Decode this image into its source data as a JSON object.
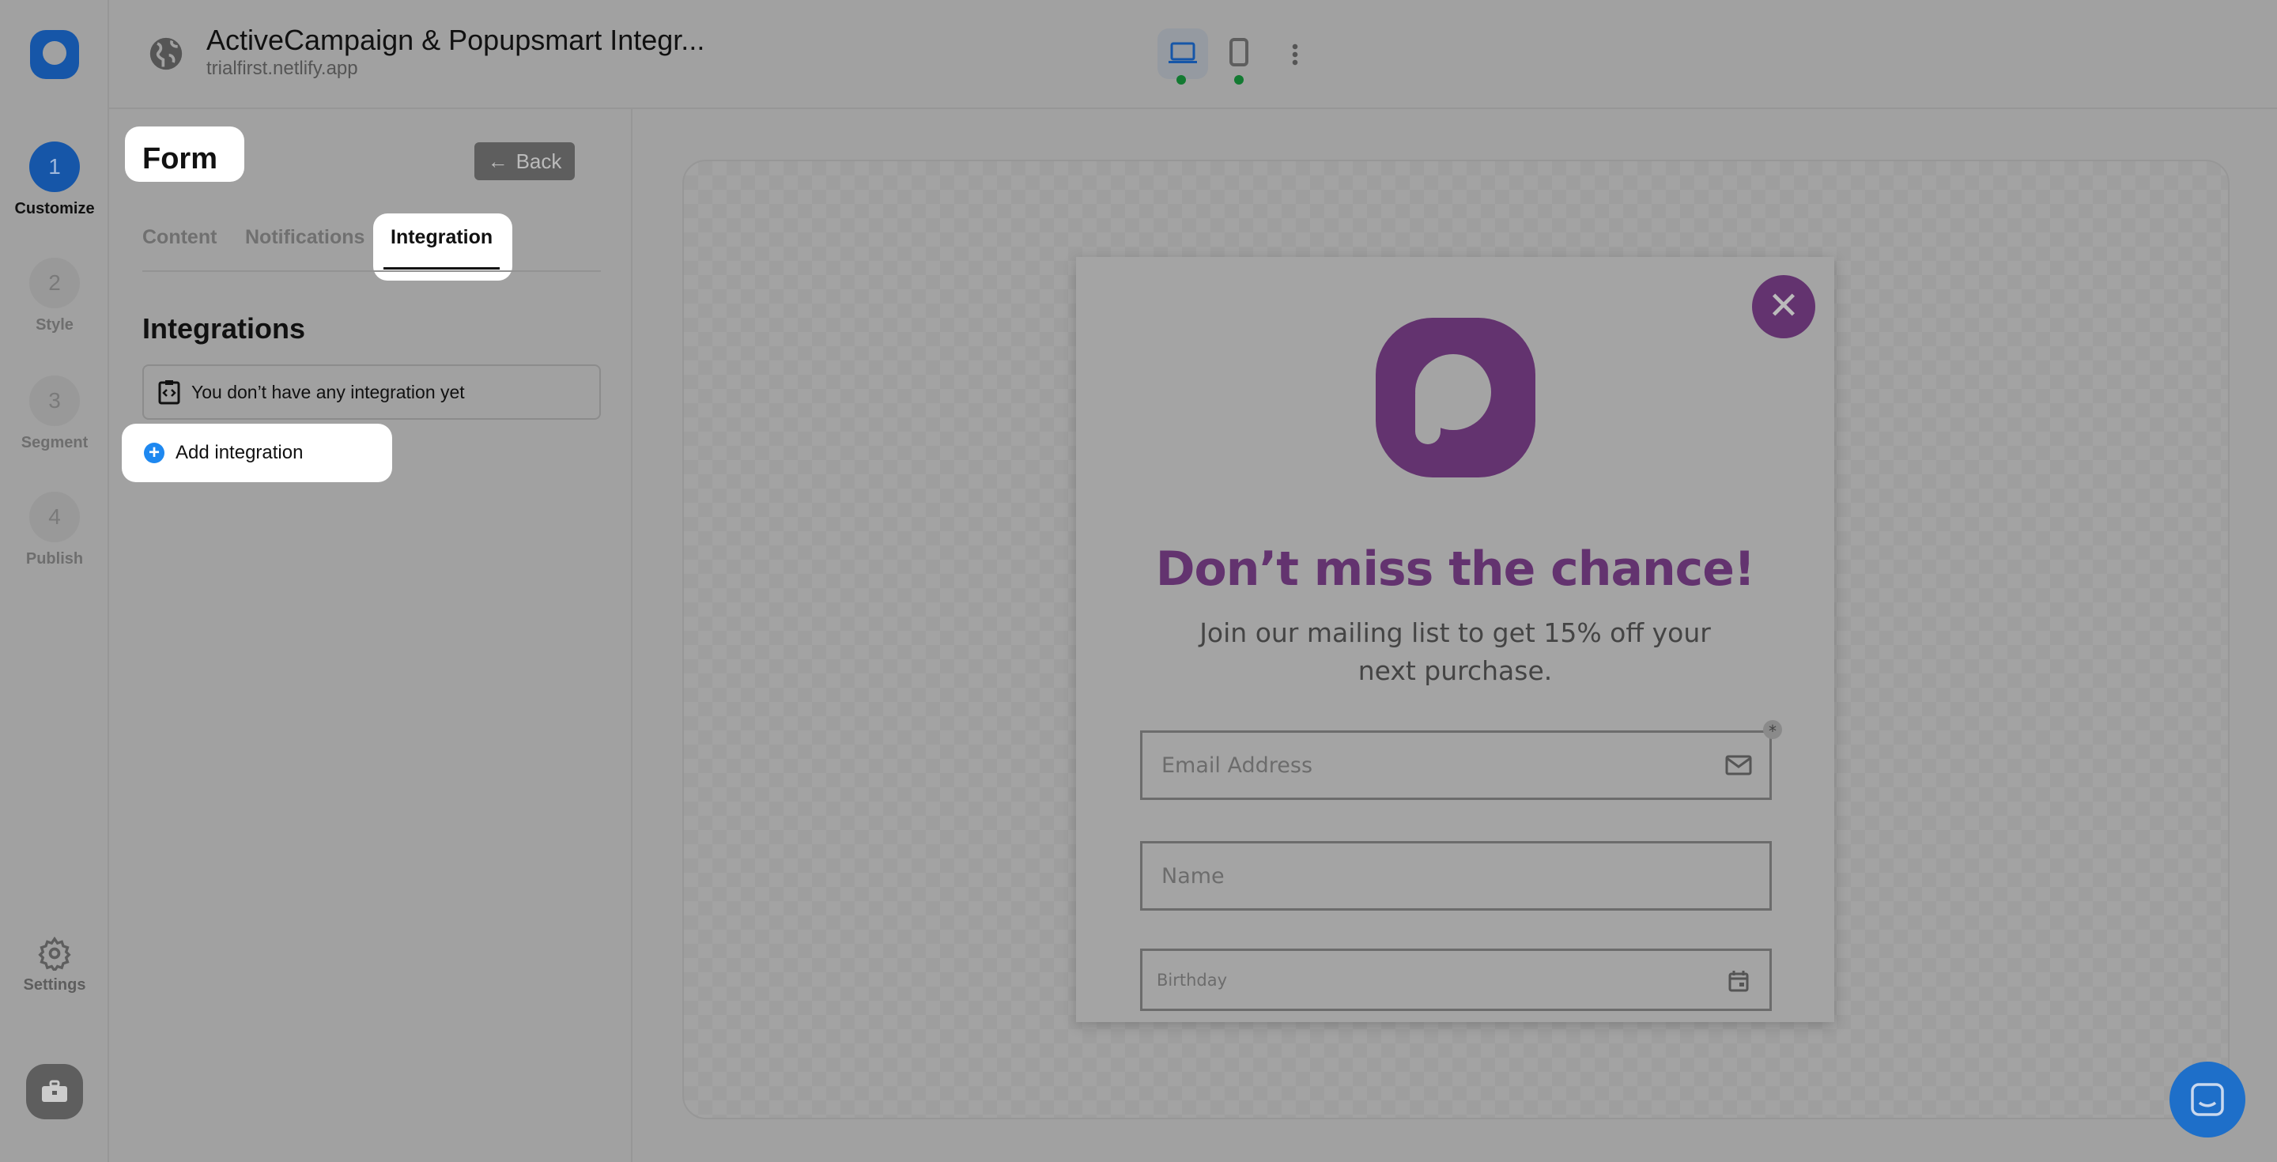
{
  "header": {
    "title": "ActiveCampaign & Popupsmart Integr...",
    "subtitle": "trialfirst.netlify.app",
    "devices": [
      "desktop",
      "mobile"
    ]
  },
  "rail": {
    "steps": [
      {
        "num": "1",
        "label": "Customize"
      },
      {
        "num": "2",
        "label": "Style"
      },
      {
        "num": "3",
        "label": "Segment"
      },
      {
        "num": "4",
        "label": "Publish"
      }
    ],
    "settings": "Settings"
  },
  "panel": {
    "title": "Form",
    "back": "Back",
    "tabs": [
      "Content",
      "Notifications",
      "Integration"
    ],
    "heading": "Integrations",
    "empty": "You don’t have any integration yet",
    "add": "Add integration"
  },
  "popup": {
    "headline": "Don’t miss the chance!",
    "subtext": "Join our mailing list to get 15% off your next purchase.",
    "email_placeholder": "Email Address",
    "required_mark": "*",
    "name_placeholder": "Name",
    "birthday_placeholder": "Birthday"
  },
  "colors": {
    "brand": "#1656a8",
    "popup_accent": "#63336f",
    "highlight": "#ffffff",
    "status": "#137a32"
  }
}
